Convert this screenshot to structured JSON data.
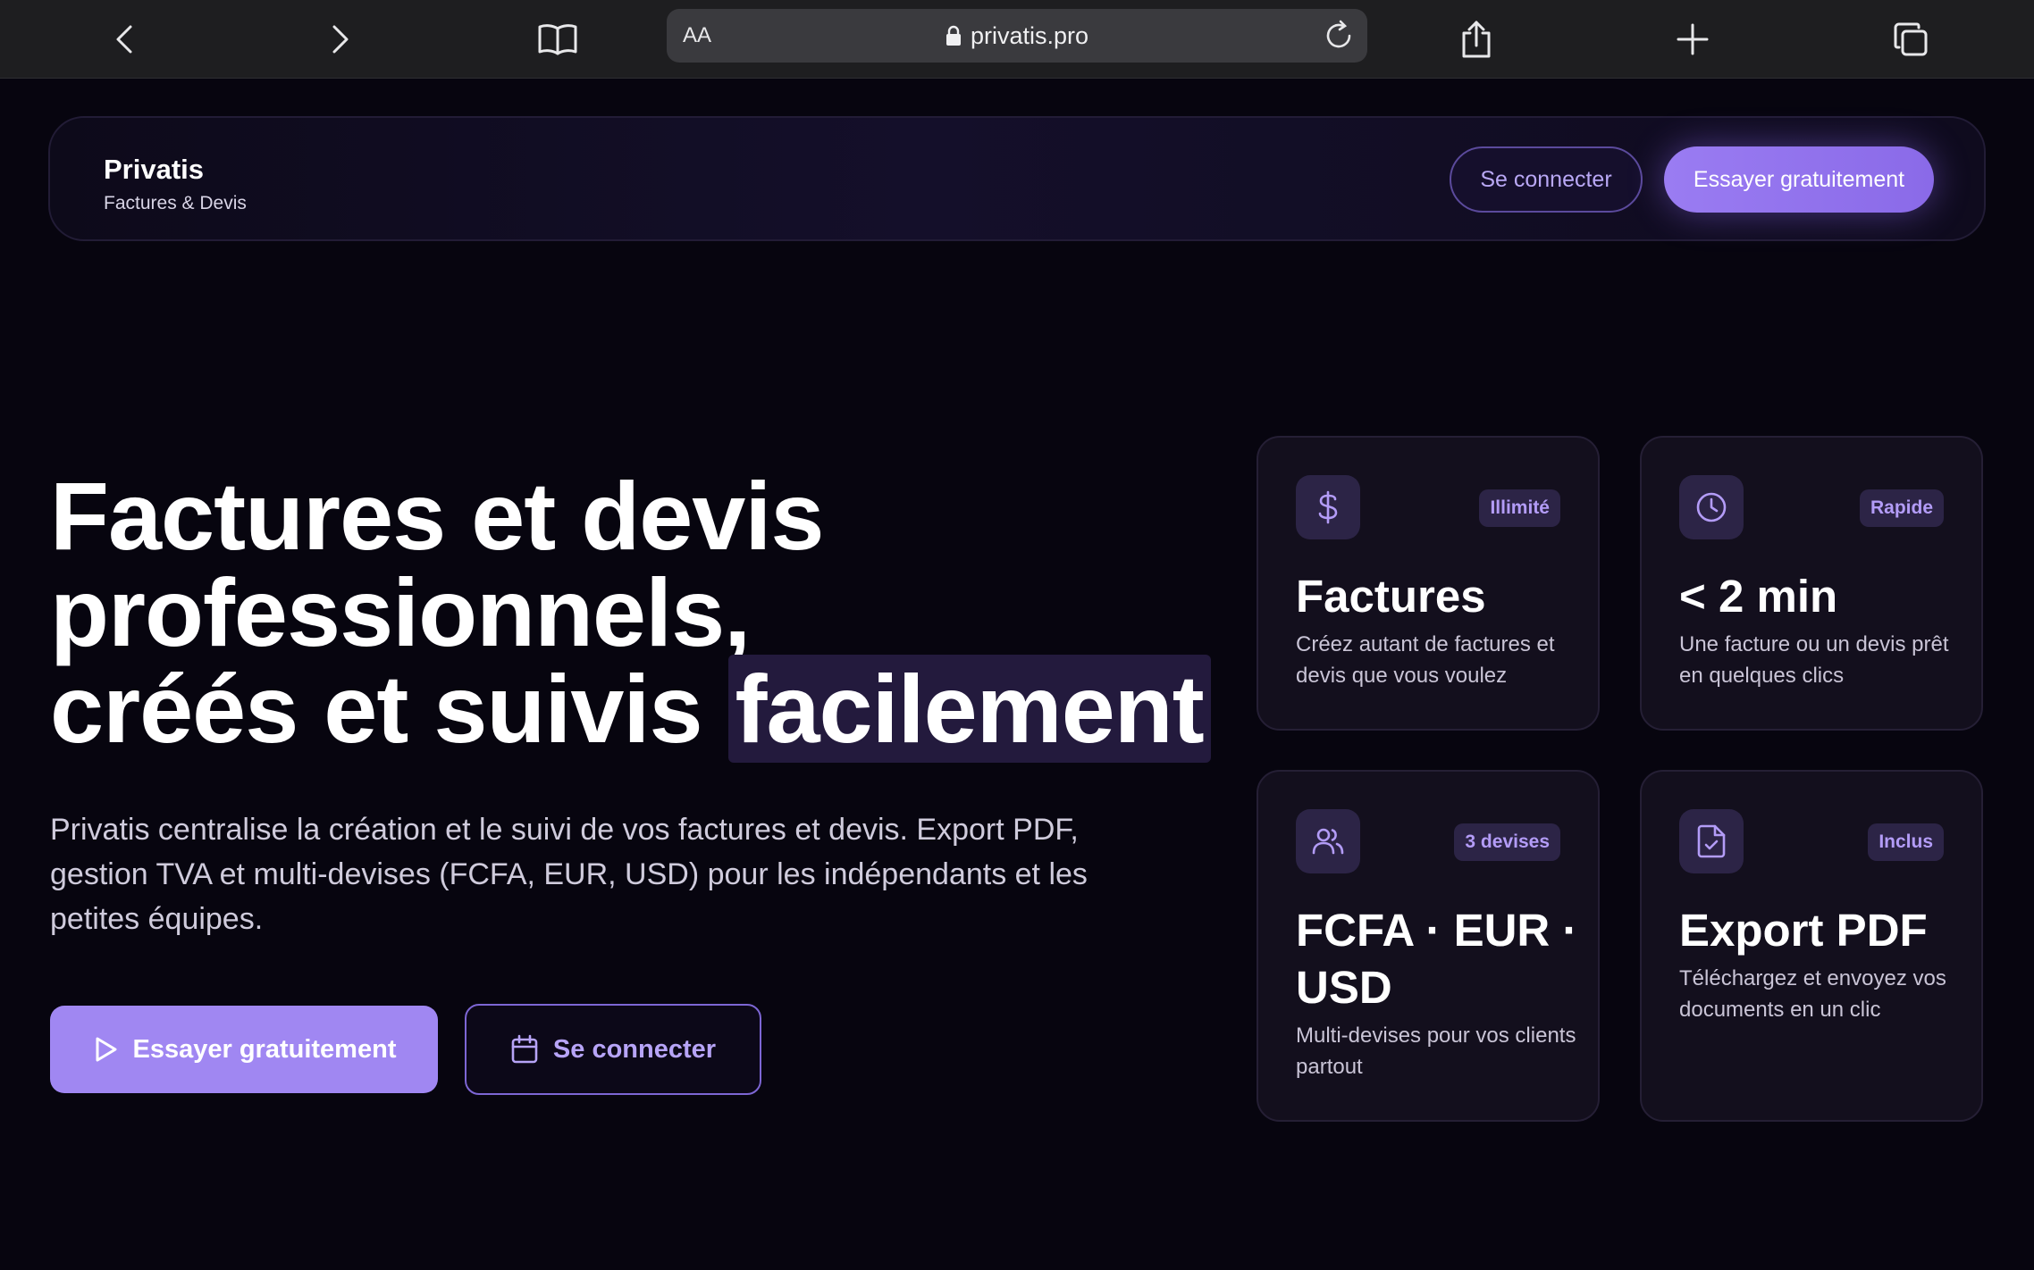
{
  "browser": {
    "url": "privatis.pro",
    "reader_label": "AA",
    "icons": {
      "back": "chevron-left-icon",
      "forward": "chevron-right-icon",
      "bookmarks": "open-book-icon",
      "lock": "lock-icon",
      "reload": "reload-icon",
      "share": "share-icon",
      "new_tab": "plus-icon",
      "tabs": "tabs-icon"
    }
  },
  "header": {
    "brand_name": "Privatis",
    "brand_subtitle": "Factures & Devis",
    "login_label": "Se connecter",
    "try_label": "Essayer gratuitement"
  },
  "hero": {
    "title_line1": "Factures et devis",
    "title_line2": "professionnels,",
    "title_line3_prefix": "créés et suivis ",
    "title_highlight": "facilement",
    "description": "Privatis centralise la création et le suivi de vos factures et devis. Export PDF, gestion TVA et multi-devises (FCFA, EUR, USD) pour les indépendants et les petites équipes.",
    "cta_try": "Essayer gratuitement",
    "cta_login": "Se connecter"
  },
  "features": [
    {
      "icon": "dollar-icon",
      "badge": "Illimité",
      "title": "Factures",
      "description": "Créez autant de factures et devis que vous voulez"
    },
    {
      "icon": "clock-icon",
      "badge": "Rapide",
      "title": "< 2 min",
      "description": "Une facture ou un devis prêt en quelques clics"
    },
    {
      "icon": "users-icon",
      "badge": "3 devises",
      "title": "FCFA · EUR · USD",
      "description": "Multi-devises pour vos clients partout"
    },
    {
      "icon": "file-check-icon",
      "badge": "Inclus",
      "title": "Export PDF",
      "description": "Téléchargez et envoyez vos documents en un clic"
    }
  ],
  "colors": {
    "background": "#07050f",
    "accent": "#a087f2",
    "accent_text": "#b39cf7",
    "card_background": "#130f1d",
    "chrome": "#1e1e20"
  }
}
